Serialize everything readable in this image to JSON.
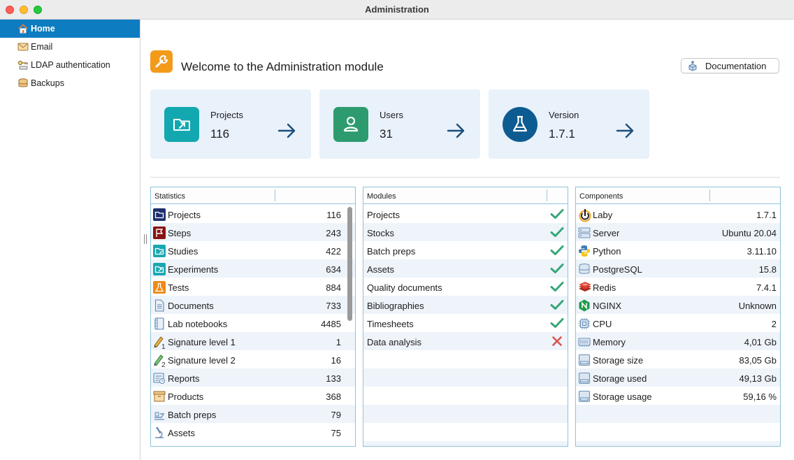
{
  "window": {
    "title": "Administration"
  },
  "sidebar": {
    "items": [
      {
        "label": "Home",
        "icon": "home-icon",
        "active": true
      },
      {
        "label": "Email",
        "icon": "envelope-icon",
        "active": false
      },
      {
        "label": "LDAP authentication",
        "icon": "ldap-key-icon",
        "active": false
      },
      {
        "label": "Backups",
        "icon": "database-icon",
        "active": false
      }
    ]
  },
  "header": {
    "welcome": "Welcome to the Administration module",
    "doc_button": "Documentation"
  },
  "cards": [
    {
      "label": "Projects",
      "value": "116",
      "icon": "folder-arrow-icon",
      "color": "#13a8b0"
    },
    {
      "label": "Users",
      "value": "31",
      "icon": "user-icon",
      "color": "#2d9b6e"
    },
    {
      "label": "Version",
      "value": "1.7.1",
      "icon": "flask-icon",
      "color": "#0d5c91"
    }
  ],
  "statistics": {
    "header": "Statistics",
    "rows": [
      {
        "name": "Projects",
        "value": "116",
        "icon": "projects-icon"
      },
      {
        "name": "Steps",
        "value": "243",
        "icon": "flag-icon"
      },
      {
        "name": "Studies",
        "value": "422",
        "icon": "study-folder-icon"
      },
      {
        "name": "Experiments",
        "value": "634",
        "icon": "experiment-folder-icon"
      },
      {
        "name": "Tests",
        "value": "884",
        "icon": "flask-icon"
      },
      {
        "name": "Documents",
        "value": "733",
        "icon": "document-icon"
      },
      {
        "name": "Lab notebooks",
        "value": "4485",
        "icon": "notebook-icon"
      },
      {
        "name": "Signature level 1",
        "value": "1",
        "icon": "pen-level-1-icon"
      },
      {
        "name": "Signature level 2",
        "value": "16",
        "icon": "pen-level-2-icon"
      },
      {
        "name": "Reports",
        "value": "133",
        "icon": "report-icon"
      },
      {
        "name": "Products",
        "value": "368",
        "icon": "box-icon"
      },
      {
        "name": "Batch preps",
        "value": "79",
        "icon": "batch-prep-icon"
      },
      {
        "name": "Assets",
        "value": "75",
        "icon": "microscope-icon"
      }
    ]
  },
  "modules": {
    "header": "Modules",
    "rows": [
      {
        "name": "Projects",
        "status": "enabled"
      },
      {
        "name": "Stocks",
        "status": "enabled"
      },
      {
        "name": "Batch preps",
        "status": "enabled"
      },
      {
        "name": "Assets",
        "status": "enabled"
      },
      {
        "name": "Quality documents",
        "status": "enabled"
      },
      {
        "name": "Bibliographies",
        "status": "enabled"
      },
      {
        "name": "Timesheets",
        "status": "enabled"
      },
      {
        "name": "Data analysis",
        "status": "disabled"
      }
    ]
  },
  "components": {
    "header": "Components",
    "rows": [
      {
        "name": "Laby",
        "value": "1.7.1",
        "icon": "laby-power-icon"
      },
      {
        "name": "Server",
        "value": "Ubuntu 20.04",
        "icon": "server-icon"
      },
      {
        "name": "Python",
        "value": "3.11.10",
        "icon": "python-icon"
      },
      {
        "name": "PostgreSQL",
        "value": "15.8",
        "icon": "database-icon"
      },
      {
        "name": "Redis",
        "value": "7.4.1",
        "icon": "redis-icon"
      },
      {
        "name": "NGINX",
        "value": "Unknown",
        "icon": "nginx-icon"
      },
      {
        "name": "CPU",
        "value": "2",
        "icon": "cpu-icon"
      },
      {
        "name": "Memory",
        "value": "4,01 Gb",
        "icon": "memory-icon"
      },
      {
        "name": "Storage size",
        "value": "83,05 Gb",
        "icon": "disk-icon"
      },
      {
        "name": "Storage used",
        "value": "49,13 Gb",
        "icon": "disk-icon"
      },
      {
        "name": "Storage usage",
        "value": "59,16 %",
        "icon": "disk-icon"
      }
    ]
  },
  "colors": {
    "accent": "#0d7cc1",
    "row_alt": "#eef4fa",
    "panel_border": "#8fc3dc",
    "card_bg": "#e9f1fa",
    "check": "#35a779",
    "cross": "#d9534f"
  }
}
